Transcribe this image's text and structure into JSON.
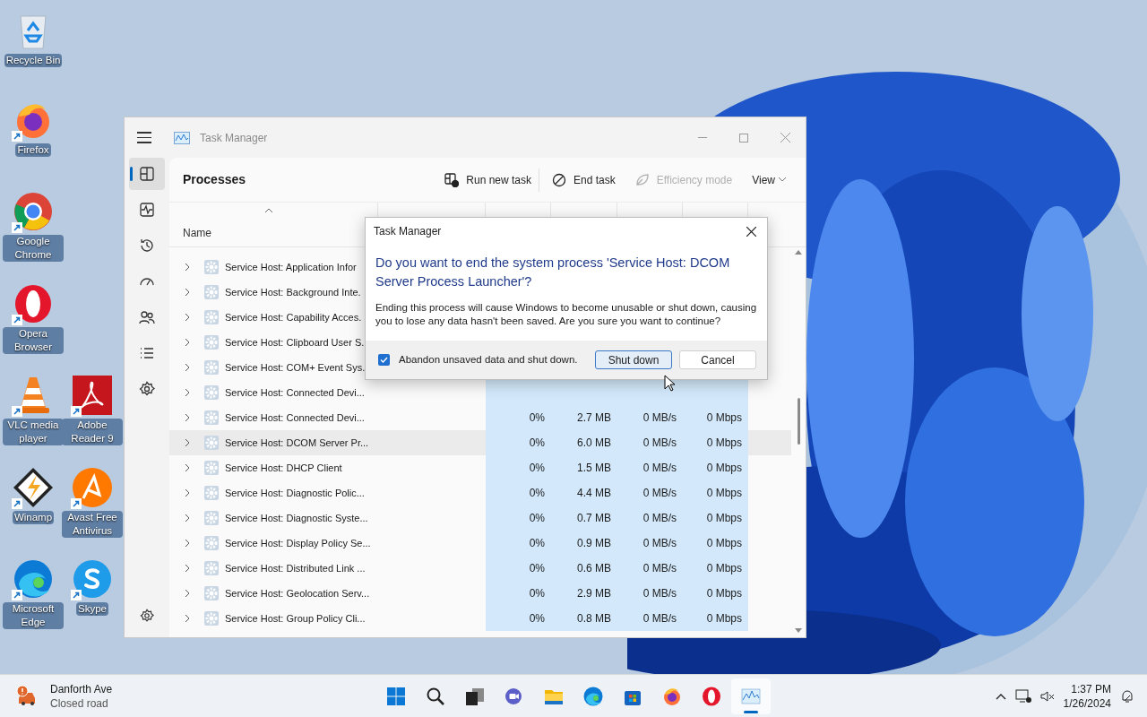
{
  "desktop_icons": [
    {
      "label": "Recycle Bin",
      "kind": "recycle",
      "shortcut": false
    },
    {
      "label": "Firefox",
      "kind": "firefox",
      "shortcut": true
    },
    {
      "label": "Google Chrome",
      "kind": "chrome",
      "shortcut": true
    },
    {
      "label": "Opera Browser",
      "kind": "opera",
      "shortcut": true
    },
    {
      "label": "VLC media player",
      "kind": "vlc",
      "shortcut": true
    },
    {
      "label": "Adobe Reader 9",
      "kind": "adobe",
      "shortcut": true
    },
    {
      "label": "Winamp",
      "kind": "winamp",
      "shortcut": true
    },
    {
      "label": "Avast Free Antivirus",
      "kind": "avast",
      "shortcut": true
    },
    {
      "label": "Microsoft Edge",
      "kind": "edge",
      "shortcut": true
    },
    {
      "label": "Skype",
      "kind": "skype",
      "shortcut": true
    }
  ],
  "window": {
    "title": "Task Manager",
    "page_title": "Processes",
    "nav": [
      {
        "kind": "processes",
        "selected": true
      },
      {
        "kind": "performance",
        "selected": false
      },
      {
        "kind": "history",
        "selected": false
      },
      {
        "kind": "startup",
        "selected": false
      },
      {
        "kind": "users",
        "selected": false
      },
      {
        "kind": "details",
        "selected": false
      },
      {
        "kind": "services",
        "selected": false
      }
    ],
    "toolbar": [
      {
        "kind": "run",
        "label": "Run new task",
        "disabled": false
      },
      {
        "kind": "end",
        "label": "End task",
        "disabled": false
      },
      {
        "kind": "efficiency",
        "label": "Efficiency mode",
        "disabled": true
      },
      {
        "kind": "view",
        "label": "View",
        "disabled": false
      }
    ],
    "table": {
      "name_column": "Name",
      "rows": [
        {
          "name": "Service Host: Application Infor",
          "selected": false,
          "expanded": false
        },
        {
          "name": "Service Host: Background Inte.",
          "selected": false,
          "expanded": false
        },
        {
          "name": "Service Host: Capability Acces.",
          "selected": false,
          "expanded": false
        },
        {
          "name": "Service Host: Clipboard User S.",
          "selected": false,
          "expanded": false
        },
        {
          "name": "Service Host: COM+ Event Sys.",
          "selected": false,
          "expanded": false
        },
        {
          "name": "Service Host: Connected Devi...",
          "selected": false,
          "expanded": false
        },
        {
          "name": "Service Host: Connected Devi...",
          "selected": false,
          "expanded": false,
          "cpu": "0%",
          "memory": "2.7 MB",
          "disk": "0 MB/s",
          "network": "0 Mbps"
        },
        {
          "name": "Service Host: DCOM Server Pr...",
          "selected": true,
          "expanded": false,
          "cpu": "0%",
          "memory": "6.0 MB",
          "disk": "0 MB/s",
          "network": "0 Mbps"
        },
        {
          "name": "Service Host: DHCP Client",
          "selected": false,
          "expanded": false,
          "cpu": "0%",
          "memory": "1.5 MB",
          "disk": "0 MB/s",
          "network": "0 Mbps"
        },
        {
          "name": "Service Host: Diagnostic Polic...",
          "selected": false,
          "expanded": false,
          "cpu": "0%",
          "memory": "4.4 MB",
          "disk": "0 MB/s",
          "network": "0 Mbps"
        },
        {
          "name": "Service Host: Diagnostic Syste...",
          "selected": false,
          "expanded": false,
          "cpu": "0%",
          "memory": "0.7 MB",
          "disk": "0 MB/s",
          "network": "0 Mbps"
        },
        {
          "name": "Service Host: Display Policy Se...",
          "selected": false,
          "expanded": false,
          "cpu": "0%",
          "memory": "0.9 MB",
          "disk": "0 MB/s",
          "network": "0 Mbps"
        },
        {
          "name": "Service Host: Distributed Link ...",
          "selected": false,
          "expanded": false,
          "cpu": "0%",
          "memory": "0.6 MB",
          "disk": "0 MB/s",
          "network": "0 Mbps"
        },
        {
          "name": "Service Host: Geolocation Serv...",
          "selected": false,
          "expanded": false,
          "cpu": "0%",
          "memory": "2.9 MB",
          "disk": "0 MB/s",
          "network": "0 Mbps"
        },
        {
          "name": "Service Host: Group Policy Cli...",
          "selected": false,
          "expanded": false,
          "cpu": "0%",
          "memory": "0.8 MB",
          "disk": "0 MB/s",
          "network": "0 Mbps"
        }
      ]
    }
  },
  "dialog": {
    "title": "Task Manager",
    "heading": "Do you want to end the system process 'Service Host: DCOM Server Process Launcher'?",
    "message": "Ending this process will cause Windows to become unusable or shut down, causing you to lose any data hasn't been saved. Are you sure you want to continue?",
    "checkbox": {
      "label": "Abandon unsaved data and shut down.",
      "checked": true
    },
    "buttons": [
      {
        "label": "Shut down",
        "default": true
      },
      {
        "label": "Cancel",
        "default": false
      }
    ]
  },
  "taskbar": {
    "weather": {
      "title": "Danforth Ave",
      "subtitle": "Closed road"
    },
    "apps": [
      {
        "kind": "start",
        "active": false
      },
      {
        "kind": "search",
        "active": false
      },
      {
        "kind": "taskview",
        "active": false
      },
      {
        "kind": "chat",
        "active": false
      },
      {
        "kind": "explorer",
        "active": false
      },
      {
        "kind": "edge",
        "active": false
      },
      {
        "kind": "store",
        "active": false
      },
      {
        "kind": "firefox",
        "active": false
      },
      {
        "kind": "opera",
        "active": false
      },
      {
        "kind": "taskmanager",
        "active": true
      }
    ],
    "time": "1:37 PM",
    "date": "1/26/2024"
  }
}
